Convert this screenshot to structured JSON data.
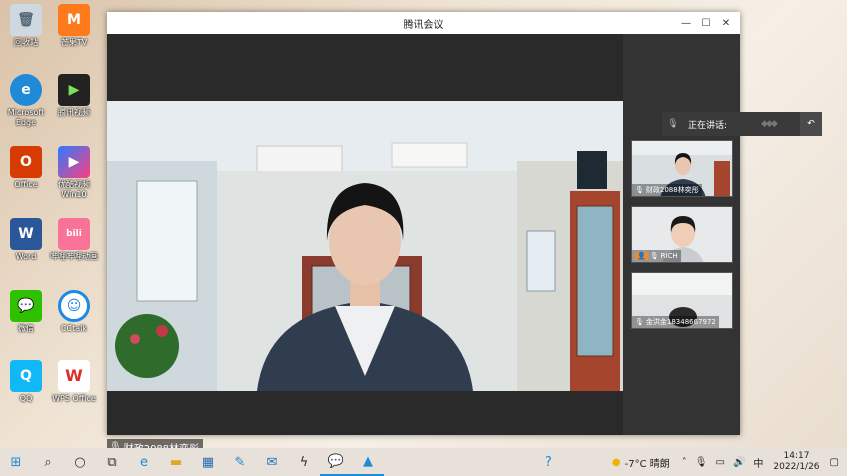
{
  "desktop": {
    "icons": [
      {
        "label": "回收站",
        "icon": "recycle-bin-icon",
        "color": "#cfd8e0"
      },
      {
        "label": "芒果TV",
        "icon": "mango-tv-icon",
        "color": "#ff7a1a"
      },
      {
        "label": "Microsoft Edge",
        "icon": "edge-icon",
        "color": "#1f8ad6"
      },
      {
        "label": "腾讯视频",
        "icon": "tencent-video-icon",
        "color": "#222222"
      },
      {
        "label": "Office",
        "icon": "office-icon",
        "color": "#d83b01"
      },
      {
        "label": "优酷视频 Win10",
        "icon": "youku-icon",
        "color": "#2a7cff"
      },
      {
        "label": "Word",
        "icon": "word-icon",
        "color": "#2b579a"
      },
      {
        "label": "哔哩哔哩动画",
        "icon": "bilibili-icon",
        "color": "#fb7299"
      },
      {
        "label": "微信",
        "icon": "wechat-icon",
        "color": "#2dc100"
      },
      {
        "label": "CCtalk",
        "icon": "cctalk-icon",
        "color": "#1e88e5"
      },
      {
        "label": "QQ",
        "icon": "qq-icon",
        "color": "#12b7f5"
      },
      {
        "label": "WPS Office",
        "icon": "wps-icon",
        "color": "#e12b2b"
      }
    ]
  },
  "window": {
    "title": "腾讯会议",
    "controls": {
      "minimize": "—",
      "maximize": "☐",
      "close": "✕"
    }
  },
  "main": {
    "speaker_name": "财政2088林奕彤"
  },
  "participants": [
    {
      "name": "财政2088林奕彤",
      "host": false
    },
    {
      "name": "RICH",
      "host": true
    },
    {
      "name": "金洪金18348667972",
      "host": false
    }
  ],
  "speaking": {
    "label": "正在讲话:"
  },
  "taskbar": {
    "weather": "-7°C 晴朗",
    "ime": "中",
    "time": "14:17",
    "date": "2022/1/26"
  },
  "colors": {
    "accent": "#1f8ad6",
    "host_badge": "#f08a24"
  }
}
